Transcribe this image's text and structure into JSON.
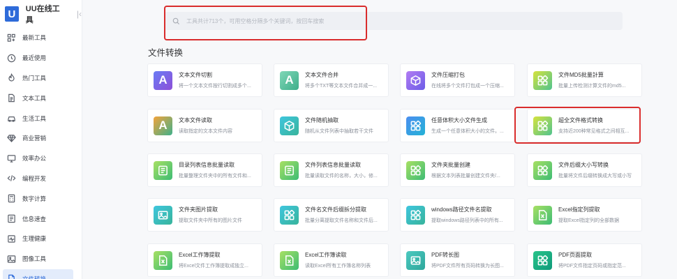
{
  "app": {
    "logo_letter": "U",
    "title": "UU在线工具",
    "collapse_icon": "collapse-left-icon"
  },
  "sidebar": {
    "items": [
      {
        "label": "最新工具",
        "icon": "grid-plus-icon"
      },
      {
        "label": "最近使用",
        "icon": "clock-icon"
      },
      {
        "label": "热门工具",
        "icon": "fire-icon"
      },
      {
        "label": "文本工具",
        "icon": "document-icon"
      },
      {
        "label": "生活工具",
        "icon": "car-icon"
      },
      {
        "label": "商业营销",
        "icon": "diamond-icon"
      },
      {
        "label": "效率办公",
        "icon": "monitor-icon"
      },
      {
        "label": "编程开发",
        "icon": "code-icon"
      },
      {
        "label": "数字计算",
        "icon": "calculator-icon"
      },
      {
        "label": "信息速查",
        "icon": "info-icon"
      },
      {
        "label": "生理健康",
        "icon": "health-icon"
      },
      {
        "label": "图像工具",
        "icon": "image-icon"
      },
      {
        "label": "文件转换",
        "icon": "file-icon",
        "active": true
      }
    ]
  },
  "search": {
    "placeholder": "工具共计713个，可用空格分隔多个关键词，按回车搜索",
    "value": ""
  },
  "section": {
    "title": "文件转换"
  },
  "cards": [
    {
      "title": "文本文件切割",
      "desc": "将一个文本文件按行切割成多个...",
      "icon": "letter-a",
      "color": "g-purple"
    },
    {
      "title": "文本文件合并",
      "desc": "将多个TXT等文本文件合并成一...",
      "icon": "letter-a",
      "color": "g-teal"
    },
    {
      "title": "文件压缩打包",
      "desc": "在线将多个文件打包成一个压缩...",
      "icon": "box-icon",
      "color": "g-violet"
    },
    {
      "title": "文件MD5批量計算",
      "desc": "批量上传检测计算文件的md5...",
      "icon": "grid-icon",
      "color": "g-lime"
    },
    {
      "title": "文本文件读取",
      "desc": "读取指定的文本文件内容",
      "icon": "letter-a",
      "color": "g-orange"
    },
    {
      "title": "文件随机抽取",
      "desc": "随机从文件列表中抽取若干文件",
      "icon": "box-icon",
      "color": "g-cyan"
    },
    {
      "title": "任意体积大小文件生成",
      "desc": "生成一个任意体积大小的文件。...",
      "icon": "grid-icon",
      "color": "g-blue"
    },
    {
      "title": "超全文件格式转换",
      "desc": "支持近200种常见格式之间相互...",
      "icon": "grid-icon",
      "color": "g-lime"
    },
    {
      "title": "目录列表信息批量读取",
      "desc": "批量整理文件夹中的所有文件和...",
      "icon": "list-icon",
      "color": "g-green"
    },
    {
      "title": "文件列表信息批量读取",
      "desc": "批量读取文件的名称，大小，修...",
      "icon": "list-icon",
      "color": "g-green"
    },
    {
      "title": "文件夹批量创建",
      "desc": "根据文本列表批量创建文件夹/...",
      "icon": "grid-icon",
      "color": "g-green"
    },
    {
      "title": "文件后缀大小写转换",
      "desc": "批量将文件后缀转换成大写或小写",
      "icon": "grid-icon",
      "color": "g-green"
    },
    {
      "title": "文件夹图片提取",
      "desc": "提取文件夹中所有的图片文件",
      "icon": "image-icon",
      "color": "g-cyan"
    },
    {
      "title": "文件名文件后缀拆分提取",
      "desc": "批量分离提取文件名称和文件后...",
      "icon": "grid-icon",
      "color": "g-cyan"
    },
    {
      "title": "windows路径文件名提取",
      "desc": "提取windows路径列表中的所有...",
      "icon": "grid-icon",
      "color": "g-cyan"
    },
    {
      "title": "Excel指定列提取",
      "desc": "提取Excel指定列的全部数据",
      "icon": "excel-icon",
      "color": "g-green"
    },
    {
      "title": "Excel工作簿提取",
      "desc": "将Excel文件工作簿提取成独立...",
      "icon": "excel-icon",
      "color": "g-green"
    },
    {
      "title": "Excel工作簿读取",
      "desc": "读取Excel所有工作簿名称列表",
      "icon": "excel-icon",
      "color": "g-green"
    },
    {
      "title": "PDF转长图",
      "desc": "将PDF文件所有页码转换为长图...",
      "icon": "image-icon",
      "color": "g-teal2"
    },
    {
      "title": "PDF页面提取",
      "desc": "将PDF文件指定页码或指定范...",
      "icon": "grid-icon",
      "color": "g-emerald"
    }
  ]
}
